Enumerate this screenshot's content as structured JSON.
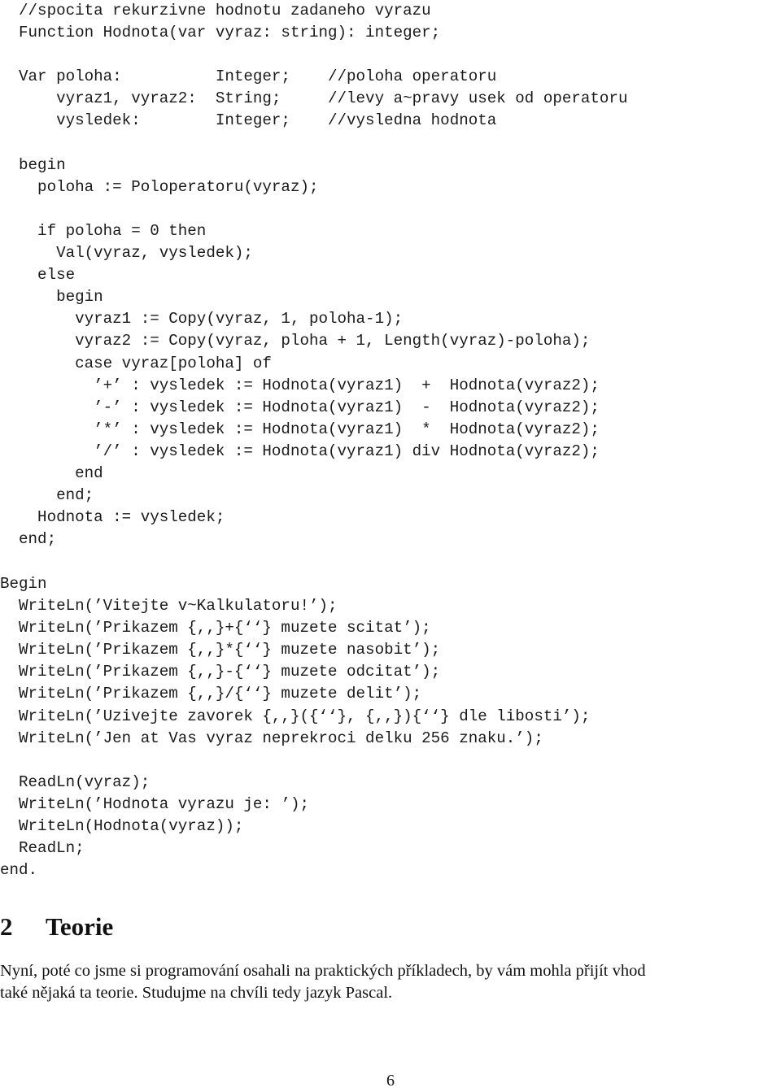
{
  "code_function": [
    "  //spocita rekurzivne hodnotu zadaneho vyrazu",
    "  Function Hodnota(var vyraz: string): integer;",
    "",
    "  Var poloha:          Integer;    //poloha operatoru",
    "      vyraz1, vyraz2:  String;     //levy a~pravy usek od operatoru",
    "      vysledek:        Integer;    //vysledna hodnota",
    "",
    "  begin",
    "    poloha := Poloperatoru(vyraz);",
    "",
    "    if poloha = 0 then",
    "      Val(vyraz, vysledek);",
    "    else",
    "      begin",
    "        vyraz1 := Copy(vyraz, 1, poloha-1);",
    "        vyraz2 := Copy(vyraz, ploha + 1, Length(vyraz)-poloha);",
    "        case vyraz[poloha] of",
    "          ’+’ : vysledek := Hodnota(vyraz1)  +  Hodnota(vyraz2);",
    "          ’-’ : vysledek := Hodnota(vyraz1)  -  Hodnota(vyraz2);",
    "          ’*’ : vysledek := Hodnota(vyraz1)  *  Hodnota(vyraz2);",
    "          ’/’ : vysledek := Hodnota(vyraz1) div Hodnota(vyraz2);",
    "        end",
    "      end;",
    "    Hodnota := vysledek;",
    "  end;"
  ],
  "code_main": [
    "Begin",
    "  WriteLn(’Vitejte v~Kalkulatoru!’);",
    "  WriteLn(’Prikazem {,,}+{‘‘} muzete scitat’);",
    "  WriteLn(’Prikazem {,,}*{‘‘} muzete nasobit’);",
    "  WriteLn(’Prikazem {,,}-{‘‘} muzete odcitat’);",
    "  WriteLn(’Prikazem {,,}/{‘‘} muzete delit’);",
    "  WriteLn(’Uzivejte zavorek {,,}({‘‘}, {,,}){‘‘} dle libosti’);",
    "  WriteLn(’Jen at Vas vyraz neprekroci delku 256 znaku.’);",
    "",
    "  ReadLn(vyraz);",
    "  WriteLn(’Hodnota vyrazu je: ’);",
    "  WriteLn(Hodnota(vyraz));",
    "  ReadLn;",
    "end."
  ],
  "section": {
    "number": "2",
    "title": "Teorie"
  },
  "paragraph": {
    "lines": [
      "Nyní, poté co jsme si programování osahali na praktických příkladech, by vám mohla přijít vhod",
      "také nějaká ta teorie. Studujme na chvíli tedy jazyk Pascal."
    ]
  },
  "page_number": "6"
}
